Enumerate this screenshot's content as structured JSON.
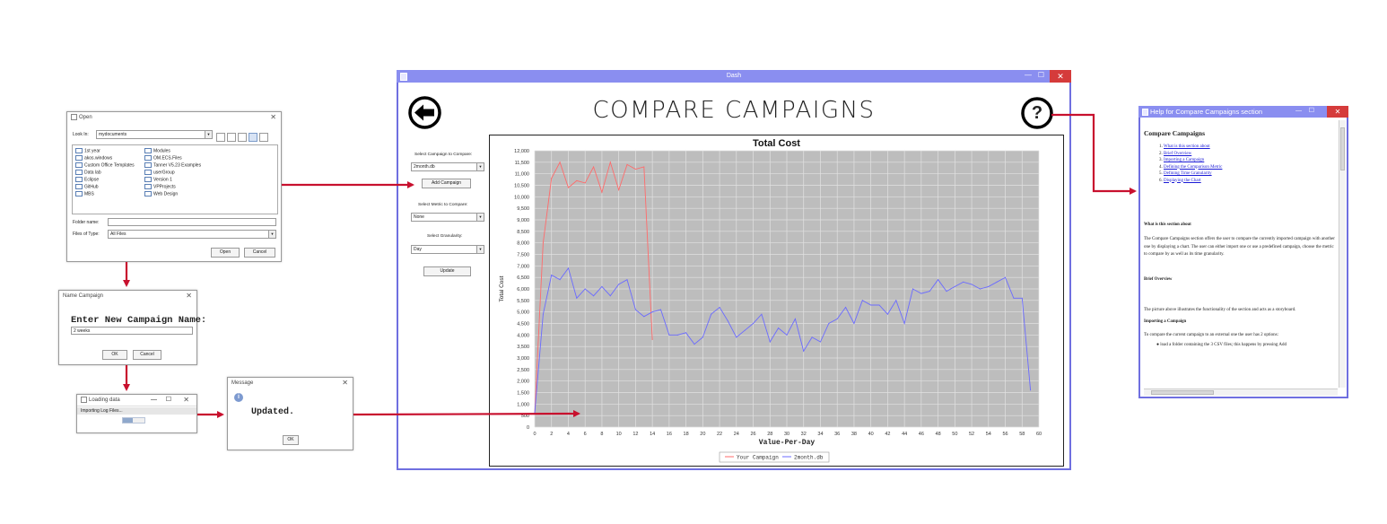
{
  "open_dialog": {
    "title": "Open",
    "close": "✕",
    "look_in_label": "Look In:",
    "look_in_value": "mydocuments",
    "files_col1": [
      "1st year",
      "akos.windows",
      "Custom Office Templates",
      "Data lab",
      "Eclipse",
      "GitHub",
      "MBS"
    ],
    "files_col2": [
      "Modules",
      "OM.ECS.Files",
      "Tanner V5.23 Examples",
      "userGroup",
      "Version 1",
      "VPProjects",
      "Web Design"
    ],
    "folder_name_label": "Folder name:",
    "folder_name_value": "",
    "files_of_type_label": "Files of Type:",
    "files_of_type_value": "All Files",
    "open_button": "Open",
    "cancel_button": "Cancel"
  },
  "name_dialog": {
    "title": "Name Campaign",
    "close": "✕",
    "prompt": "Enter New Campaign Name:",
    "input_value": "2 weeks",
    "ok_button": "OK",
    "cancel_button": "Cancel"
  },
  "loading_dialog": {
    "title": "Loading data",
    "minimize": "—",
    "maximize": "☐",
    "close": "✕",
    "status": "Importing Log Files...",
    "progress": 0.45
  },
  "message_dialog": {
    "title": "Message",
    "close": "✕",
    "info_glyph": "i",
    "text": "Updated.",
    "ok_button": "OK"
  },
  "dash": {
    "title": "Dash",
    "minimize": "—",
    "maximize": "☐",
    "close": "✕",
    "heading": "COMPARE CAMPAIGNS",
    "help_glyph": "?",
    "select_campaign_label": "Select Campaign to Compare:",
    "select_campaign_value": "2month.db",
    "add_campaign_button": "Add Campaign",
    "select_metric_label": "Select Metric to Compare:",
    "select_metric_value": "None",
    "select_granularity_label": "Select Granularity:",
    "select_granularity_value": "Day",
    "update_button": "Update"
  },
  "help_window": {
    "title": "Help for Compare Campaigns section",
    "minimize": "—",
    "maximize": "☐",
    "close": "✕",
    "heading": "Compare Campaigns",
    "toc": [
      "What is this section about",
      "Brief Overview",
      "Importing a Campaign",
      "Defining the Comparison Metric",
      "Defining Time Granularity",
      "Displaying the Chart"
    ],
    "section1_title": "What is this section about",
    "section1_text": "The Compare Campaigns section offers the user to compare the currently imported campaign with another one by displaying a chart. The user can either import one or use a predefined campaign, choose the metric to compare by as well as its time granularity.",
    "section2_title": "Brief Overview",
    "section2_text": "The picture above illustrates the functionality of the section and acts as a storyboard.",
    "section3_title": "Importing a Campaign",
    "section3_text": "To compare the current campaign to an external one the user has 2 options:",
    "section3_bullet": "load a folder containing the 3 CSV files; this happens by pressing Add"
  },
  "colors": {
    "accent_frame": "#6f6fe0",
    "arrow": "#c8102e",
    "series1": "#ff6b6b",
    "series2": "#6b6bff",
    "plot_bg": "#bdbdbd"
  },
  "chart_data": {
    "type": "line",
    "title": "Total Cost",
    "xlabel": "Value-Per-Day",
    "ylabel": "Total Cost",
    "xlim": [
      0,
      60
    ],
    "ylim": [
      0,
      12000
    ],
    "xticks": [
      0,
      2,
      4,
      6,
      8,
      10,
      12,
      14,
      16,
      18,
      20,
      22,
      24,
      26,
      28,
      30,
      32,
      34,
      36,
      38,
      40,
      42,
      44,
      46,
      48,
      50,
      52,
      54,
      56,
      58,
      60
    ],
    "yticks": [
      0,
      500,
      1000,
      1500,
      2000,
      2500,
      3000,
      3500,
      4000,
      4500,
      5000,
      5500,
      6000,
      6500,
      7000,
      7500,
      8000,
      8500,
      9000,
      9500,
      10000,
      10500,
      11000,
      11500,
      12000
    ],
    "ytick_labels": [
      "0",
      "500",
      "1,000",
      "1,500",
      "2,000",
      "2,500",
      "3,000",
      "3,500",
      "4,000",
      "4,500",
      "5,000",
      "5,500",
      "6,000",
      "6,500",
      "7,000",
      "7,500",
      "8,000",
      "8,500",
      "9,000",
      "9,500",
      "10,000",
      "10,500",
      "11,000",
      "11,500",
      "12,000"
    ],
    "grid": true,
    "legend_position": "bottom",
    "series": [
      {
        "name": "Your Campaign",
        "color": "#ff6b6b",
        "x": [
          0,
          1,
          2,
          3,
          4,
          5,
          6,
          7,
          8,
          9,
          10,
          11,
          12,
          13,
          14
        ],
        "y": [
          600,
          8000,
          10800,
          11500,
          10400,
          10700,
          10600,
          11300,
          10200,
          11500,
          10300,
          11400,
          11200,
          11300,
          3800
        ]
      },
      {
        "name": "2month.db",
        "color": "#6b6bff",
        "x": [
          0,
          1,
          2,
          3,
          4,
          5,
          6,
          7,
          8,
          9,
          10,
          11,
          12,
          13,
          14,
          15,
          16,
          17,
          18,
          19,
          20,
          21,
          22,
          23,
          24,
          25,
          26,
          27,
          28,
          29,
          30,
          31,
          32,
          33,
          34,
          35,
          36,
          37,
          38,
          39,
          40,
          41,
          42,
          43,
          44,
          45,
          46,
          47,
          48,
          49,
          50,
          51,
          52,
          53,
          54,
          55,
          56,
          57,
          58,
          59
        ],
        "y": [
          600,
          4900,
          6600,
          6400,
          6900,
          5600,
          6000,
          5700,
          6100,
          5700,
          6200,
          6400,
          5100,
          4800,
          5000,
          5100,
          4000,
          4000,
          4100,
          3600,
          3900,
          4900,
          5200,
          4600,
          3900,
          4200,
          4500,
          4900,
          3700,
          4300,
          4000,
          4700,
          3300,
          3900,
          3700,
          4500,
          4700,
          5200,
          4500,
          5500,
          5300,
          5300,
          4900,
          5500,
          4500,
          6000,
          5800,
          5900,
          6400,
          5900,
          6100,
          6300,
          6200,
          6000,
          6100,
          6300,
          6500,
          5600,
          5600,
          1600
        ]
      }
    ]
  }
}
